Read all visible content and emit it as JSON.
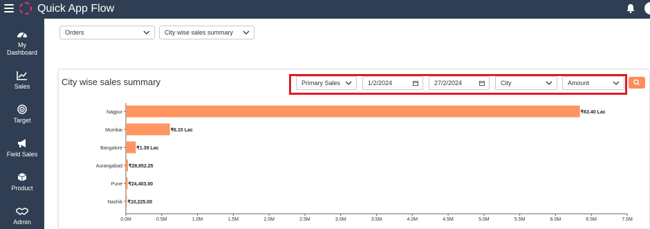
{
  "app": {
    "title": "Quick App Flow"
  },
  "sidebar": {
    "items": [
      {
        "label_line1": "My",
        "label_line2": "Dashboard",
        "icon": "dashboard-icon"
      },
      {
        "label_line1": "Sales",
        "label_line2": "",
        "icon": "chart-line-icon"
      },
      {
        "label_line1": "Target",
        "label_line2": "",
        "icon": "target-icon"
      },
      {
        "label_line1": "Field Sales",
        "label_line2": "",
        "icon": "megaphone-icon"
      },
      {
        "label_line1": "Product",
        "label_line2": "",
        "icon": "box-icon"
      },
      {
        "label_line1": "Admin",
        "label_line2": "",
        "icon": "handshake-icon"
      }
    ]
  },
  "selectors": {
    "module": "Orders",
    "report": "City wise sales summary"
  },
  "card": {
    "title": "City wise sales summary",
    "filters": {
      "sales_type": "Primary Sales",
      "from_date": "1/2/2024",
      "to_date": "27/2/2024",
      "group_by": "City",
      "measure": "Amount"
    }
  },
  "colors": {
    "bar": "#ff9561",
    "header": "#2f3e52",
    "accent": "#ff8c5a",
    "highlight": "#e01b24"
  },
  "chart_data": {
    "type": "bar",
    "orientation": "horizontal",
    "categories": [
      "Nagpur",
      "Mumbai",
      "Bangalore",
      "Aurangabad",
      "Pune",
      "Nashik"
    ],
    "values": [
      6340000,
      615000,
      139000,
      28952.25,
      24403.0,
      10225.0
    ],
    "value_labels": [
      "₹63.40 Lac",
      "₹6.15 Lac",
      "₹1.39 Lac",
      "₹28,952.25",
      "₹24,403.00",
      "₹10,225.00"
    ],
    "xlim": [
      0,
      7000000
    ],
    "xticks": [
      0,
      500000,
      1000000,
      1500000,
      2000000,
      2500000,
      3000000,
      3500000,
      4000000,
      4500000,
      5000000,
      5500000,
      6000000,
      6500000,
      7000000
    ],
    "xtick_labels": [
      "0.0M",
      "0.5M",
      "1.0M",
      "1.5M",
      "2.0M",
      "2.5M",
      "3.0M",
      "3.5M",
      "4.0M",
      "4.5M",
      "5.0M",
      "5.5M",
      "6.0M",
      "6.5M",
      "7.0M"
    ],
    "grid": false
  }
}
